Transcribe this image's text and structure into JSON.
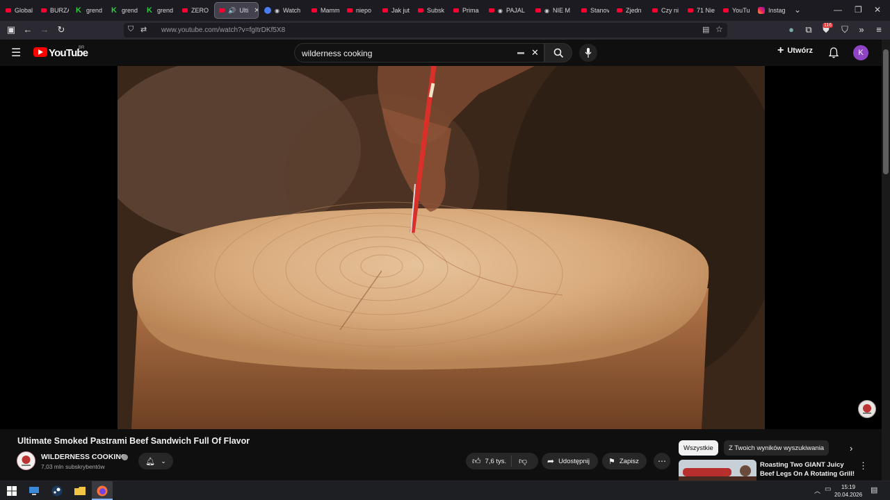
{
  "browser": {
    "tabs": [
      {
        "label": "Global",
        "icon": "youtube-icon"
      },
      {
        "label": "BURZA",
        "icon": "youtube-icon"
      },
      {
        "label": "grend",
        "icon": "k-icon"
      },
      {
        "label": "grend",
        "icon": "k-icon"
      },
      {
        "label": "grend",
        "icon": "k-icon"
      },
      {
        "label": "ZERO",
        "icon": "youtube-icon"
      },
      {
        "label": "Ulti",
        "icon": "youtube-icon",
        "active": true
      },
      {
        "label": "Watch",
        "icon": "globe-icon"
      },
      {
        "label": "Mamm",
        "icon": "youtube-icon"
      },
      {
        "label": "niepo",
        "icon": "youtube-icon"
      },
      {
        "label": "Jak jut",
        "icon": "youtube-icon"
      },
      {
        "label": "Subsk",
        "icon": "youtube-icon"
      },
      {
        "label": "Prima",
        "icon": "youtube-icon"
      },
      {
        "label": "PAJAL",
        "icon": "youtube-icon"
      },
      {
        "label": "NIE M",
        "icon": "youtube-icon"
      },
      {
        "label": "Stanov",
        "icon": "youtube-icon"
      },
      {
        "label": "Zjedn",
        "icon": "youtube-icon"
      },
      {
        "label": "Czy ni",
        "icon": "youtube-icon"
      },
      {
        "label": "71 Nie",
        "icon": "youtube-icon"
      },
      {
        "label": "YouTu",
        "icon": "youtube-icon"
      },
      {
        "label": "Instag",
        "icon": "instagram-icon"
      }
    ],
    "url": "www.youtube.com/watch?v=fgItrDKf5X8",
    "extension_badge": "116"
  },
  "youtube": {
    "logo_text": "YouTube",
    "region": "BR",
    "search_value": "wilderness cooking",
    "create_label": "Utwórz",
    "avatar_letter": "K"
  },
  "video": {
    "title": "Ultimate Smoked Pastrami Beef Sandwich Full Of Flavor",
    "channel_name": "WILDERNESS COOKING",
    "subscribers": "7,03 mln subskrybentów",
    "likes": "7,6 tys.",
    "share_label": "Udostępnij",
    "save_label": "Zapisz"
  },
  "sidebar": {
    "chips": [
      "Wszystkie",
      "Z Twoich wyników wyszukiwania"
    ],
    "related_title": "Roasting Two GIANT Juicy Beef Legs On A Rotating Grill!"
  },
  "taskbar": {
    "time": "15:19",
    "date": "20.04.2026"
  },
  "colors": {
    "accent": "#ff0000",
    "avatar": "#8e44c4",
    "background": "#0f0f0f"
  }
}
